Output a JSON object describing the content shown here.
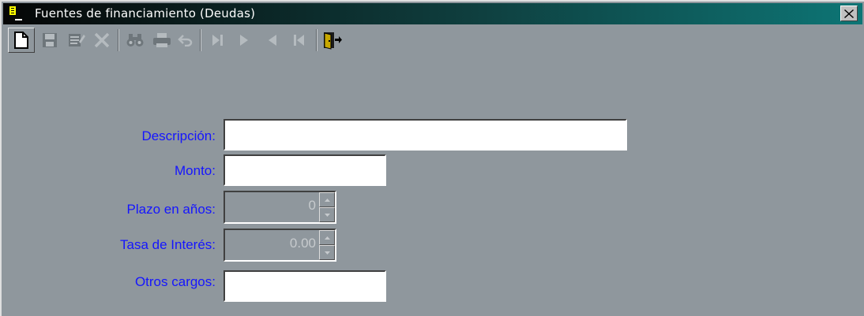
{
  "window": {
    "title": "Fuentes de financiamiento (Deudas)"
  },
  "toolbar": {
    "buttons": [
      {
        "icon": "new-document-icon"
      },
      {
        "icon": "save-icon"
      },
      {
        "icon": "edit-icon"
      },
      {
        "icon": "delete-icon"
      },
      {
        "icon": "find-icon"
      },
      {
        "icon": "print-icon"
      },
      {
        "icon": "undo-icon"
      },
      {
        "icon": "last-record-icon"
      },
      {
        "icon": "next-record-icon"
      },
      {
        "icon": "previous-record-icon"
      },
      {
        "icon": "first-record-icon"
      },
      {
        "icon": "exit-icon"
      }
    ]
  },
  "form": {
    "descripcion_label": "Descripción:",
    "descripcion_value": "",
    "monto_label": "Monto:",
    "monto_value": "",
    "plazo_label": "Plazo en años:",
    "plazo_value": "0",
    "tasa_label": "Tasa de Interés:",
    "tasa_value": "0.00",
    "otros_label": "Otros cargos:",
    "otros_value": ""
  },
  "colors": {
    "label": "#1515ff",
    "background": "#8f979d"
  }
}
